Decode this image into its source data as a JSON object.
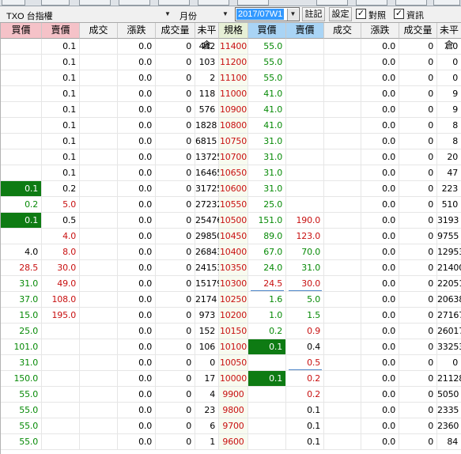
{
  "toolbar": {
    "product": "TXO 台指權",
    "period": "月份",
    "date": "2017/07W1",
    "note_label": "註記",
    "settings_label": "設定",
    "compare_label": "對照",
    "compare_checked": true,
    "info_label": "資訊",
    "info_checked": true
  },
  "columns": [
    "買價",
    "賣價",
    "成交",
    "漲跌",
    "成交量",
    "未平倉",
    "規格",
    "買價",
    "賣價",
    "成交",
    "漲跌",
    "成交量",
    "未平倉"
  ],
  "colors": {
    "up": "#c81010",
    "down": "#078a07",
    "highlight": "#0e7b13"
  },
  "rows": [
    [
      "",
      "0.1",
      "",
      "0.0",
      "0",
      "442",
      "11400",
      "55.0",
      "",
      "",
      "0.0",
      "0",
      "0"
    ],
    [
      "",
      "0.1",
      "",
      "0.0",
      "0",
      "103",
      "11200",
      "55.0",
      "",
      "",
      "0.0",
      "0",
      "0"
    ],
    [
      "",
      "0.1",
      "",
      "0.0",
      "0",
      "2",
      "11100",
      "55.0",
      "",
      "",
      "0.0",
      "0",
      "0"
    ],
    [
      "",
      "0.1",
      "",
      "0.0",
      "0",
      "118",
      "11000",
      "41.0",
      "",
      "",
      "0.0",
      "0",
      "9"
    ],
    [
      "",
      "0.1",
      "",
      "0.0",
      "0",
      "576",
      "10900",
      "41.0",
      "",
      "",
      "0.0",
      "0",
      "9"
    ],
    [
      "",
      "0.1",
      "",
      "0.0",
      "0",
      "1828",
      "10800",
      "41.0",
      "",
      "",
      "0.0",
      "0",
      "8"
    ],
    [
      "",
      "0.1",
      "",
      "0.0",
      "0",
      "6815",
      "10750",
      "31.0",
      "",
      "",
      "0.0",
      "0",
      "8"
    ],
    [
      "",
      "0.1",
      "",
      "0.0",
      "0",
      "13725",
      "10700",
      "31.0",
      "",
      "",
      "0.0",
      "0",
      "20"
    ],
    [
      "",
      "0.1",
      "",
      "0.0",
      "0",
      "16465",
      "10650",
      "31.0",
      "",
      "",
      "0.0",
      "0",
      "47"
    ],
    [
      "0.1",
      "0.2",
      "",
      "0.0",
      "0",
      "31725",
      "10600",
      "31.0",
      "",
      "",
      "0.0",
      "0",
      "223"
    ],
    [
      "0.2",
      "5.0",
      "",
      "0.0",
      "0",
      "27232",
      "10550",
      "25.0",
      "",
      "",
      "0.0",
      "0",
      "510"
    ],
    [
      "0.1",
      "0.5",
      "",
      "0.0",
      "0",
      "25476",
      "10500",
      "151.0",
      "190.0",
      "",
      "0.0",
      "0",
      "3193"
    ],
    [
      "",
      "4.0",
      "",
      "0.0",
      "0",
      "29850",
      "10450",
      "89.0",
      "123.0",
      "",
      "0.0",
      "0",
      "9755"
    ],
    [
      "4.0",
      "8.0",
      "",
      "0.0",
      "0",
      "26843",
      "10400",
      "67.0",
      "70.0",
      "",
      "0.0",
      "0",
      "12953"
    ],
    [
      "28.5",
      "30.0",
      "",
      "0.0",
      "0",
      "24153",
      "10350",
      "24.0",
      "31.0",
      "",
      "0.0",
      "0",
      "21400"
    ],
    [
      "31.0",
      "49.0",
      "",
      "0.0",
      "0",
      "15179",
      "10300",
      "24.5",
      "30.0",
      "",
      "0.0",
      "0",
      "22051"
    ],
    [
      "37.0",
      "108.0",
      "",
      "0.0",
      "0",
      "2174",
      "10250",
      "1.6",
      "5.0",
      "",
      "0.0",
      "0",
      "20638"
    ],
    [
      "15.0",
      "195.0",
      "",
      "0.0",
      "0",
      "973",
      "10200",
      "1.0",
      "1.5",
      "",
      "0.0",
      "0",
      "27167"
    ],
    [
      "25.0",
      "",
      "",
      "0.0",
      "0",
      "152",
      "10150",
      "0.2",
      "0.9",
      "",
      "0.0",
      "0",
      "26017"
    ],
    [
      "101.0",
      "",
      "",
      "0.0",
      "0",
      "106",
      "10100",
      "0.1",
      "0.4",
      "",
      "0.0",
      "0",
      "33253"
    ],
    [
      "31.0",
      "",
      "",
      "0.0",
      "0",
      "0",
      "10050",
      "",
      "0.5",
      "",
      "0.0",
      "0",
      "0"
    ],
    [
      "150.0",
      "",
      "",
      "0.0",
      "0",
      "17",
      "10000",
      "0.1",
      "0.2",
      "",
      "0.0",
      "0",
      "21128"
    ],
    [
      "55.0",
      "",
      "",
      "0.0",
      "0",
      "4",
      "9900",
      "",
      "0.2",
      "",
      "0.0",
      "0",
      "5050"
    ],
    [
      "55.0",
      "",
      "",
      "0.0",
      "0",
      "23",
      "9800",
      "",
      "0.1",
      "",
      "0.0",
      "0",
      "2335"
    ],
    [
      "55.0",
      "",
      "",
      "0.0",
      "0",
      "6",
      "9700",
      "",
      "0.1",
      "",
      "0.0",
      "0",
      "2360"
    ],
    [
      "55.0",
      "",
      "",
      "0.0",
      "0",
      "1",
      "9600",
      "",
      "0.1",
      "",
      "0.0",
      "0",
      "84"
    ]
  ]
}
